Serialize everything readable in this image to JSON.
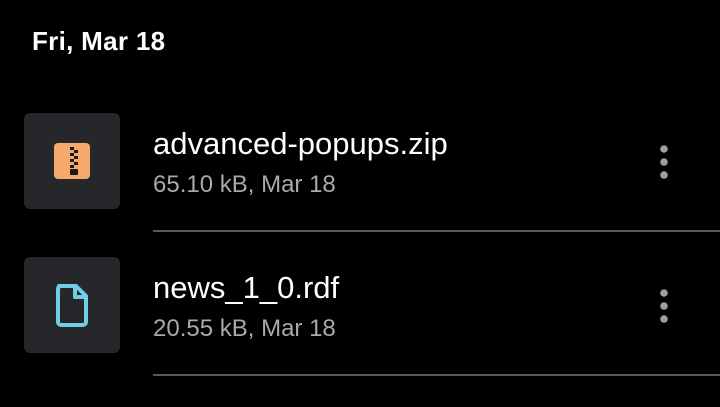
{
  "section": {
    "date_header": "Fri, Mar 18"
  },
  "files": [
    {
      "name": "advanced-popups.zip",
      "meta": "65.10 kB, Mar 18",
      "icon": "zip-archive-icon",
      "icon_color": "#f6a96b"
    },
    {
      "name": "news_1_0.rdf",
      "meta": "20.55 kB, Mar 18",
      "icon": "document-file-icon",
      "icon_color": "#6fcfe8"
    }
  ],
  "colors": {
    "background": "#000000",
    "thumbnail_bg": "#26272a",
    "primary_text": "#ffffff",
    "secondary_text": "#a9a9ad",
    "divider": "#5a5a5e"
  }
}
